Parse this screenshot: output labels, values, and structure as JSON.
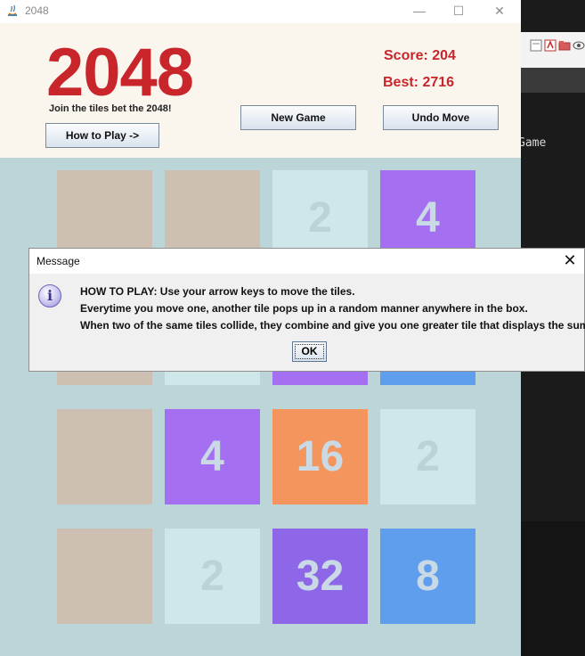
{
  "window": {
    "title": "2048",
    "minimize": "—",
    "maximize": "☐",
    "close": "✕"
  },
  "header": {
    "logo": "2048",
    "tagline": "Join the tiles bet the 2048!",
    "score": "Score: 204",
    "best": "Best: 2716",
    "how_to_play_label": "How to Play ->",
    "new_game_label": "New Game",
    "undo_label": "Undo Move"
  },
  "board": {
    "tiles": [
      {
        "value": "",
        "bg": "#cdbfb1",
        "fg": "#cdbfb1"
      },
      {
        "value": "",
        "bg": "#cdbfb1",
        "fg": "#cdbfb1"
      },
      {
        "value": "2",
        "bg": "#cfe7e8",
        "fg": "#b9d3d6"
      },
      {
        "value": "4",
        "bg": "#a56ff2",
        "fg": "#c9d9e6"
      },
      {
        "value": "",
        "bg": "#cdbfb1",
        "fg": "#cdbfb1"
      },
      {
        "value": "",
        "bg": "#cfe7e8",
        "fg": "#b9d3d6"
      },
      {
        "value": "",
        "bg": "#a56ff2",
        "fg": "#c9d9e6"
      },
      {
        "value": "",
        "bg": "#5f9ded",
        "fg": "#c9d9e6"
      },
      {
        "value": "",
        "bg": "#cdbfb1",
        "fg": "#cdbfb1"
      },
      {
        "value": "4",
        "bg": "#a56ff2",
        "fg": "#c9d9e6"
      },
      {
        "value": "16",
        "bg": "#f5955e",
        "fg": "#c9d9e6"
      },
      {
        "value": "2",
        "bg": "#cfe7e8",
        "fg": "#b9d3d6"
      },
      {
        "value": "",
        "bg": "#cdbfb1",
        "fg": "#cdbfb1"
      },
      {
        "value": "2",
        "bg": "#cfe7e8",
        "fg": "#b9d3d6"
      },
      {
        "value": "32",
        "bg": "#8d67e8",
        "fg": "#c9d9e6"
      },
      {
        "value": "8",
        "bg": "#5f9ded",
        "fg": "#c9d9e6"
      }
    ]
  },
  "dialog": {
    "title": "Message",
    "close": "✕",
    "icon": "info-icon",
    "line1": "HOW TO PLAY: Use your arrow keys to move the tiles.",
    "line2": "Everytime you move one, another tile pops up in a random manner anywhere in the box.",
    "line3": "When two of the same tiles collide, they combine and give you one greater tile that displays the sum",
    "ok_label": "OK"
  },
  "background": {
    "console_text": "Game"
  },
  "colors": {
    "accent": "#c8262b",
    "board": "#bcd5d8",
    "header": "#faf6ee"
  }
}
